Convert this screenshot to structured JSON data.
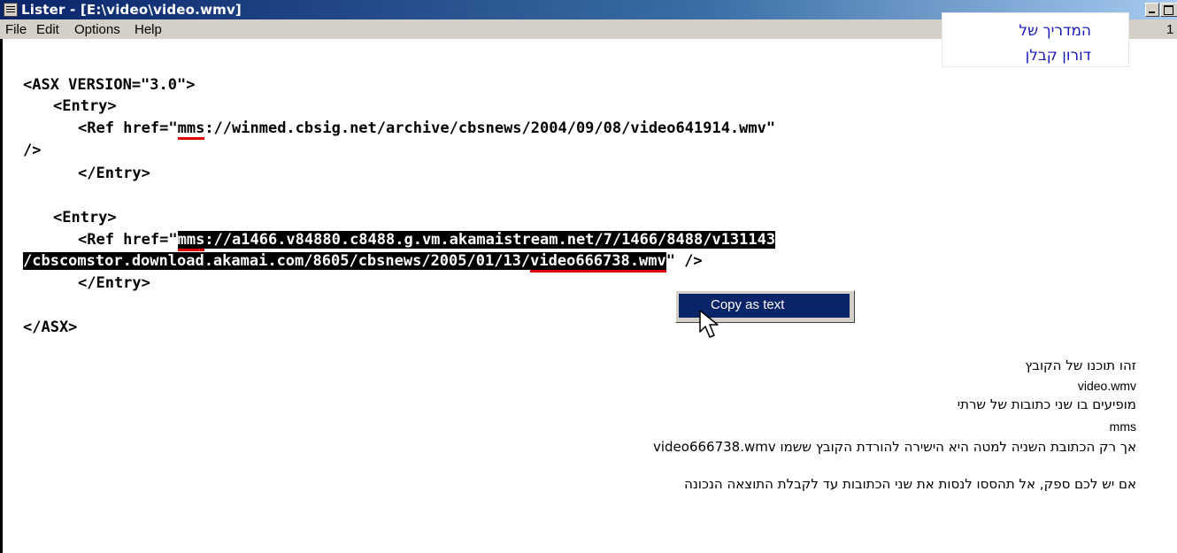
{
  "window": {
    "title": "Lister - [E:\\video\\video.wmv]",
    "page_indicator": "1"
  },
  "menu": {
    "items": [
      "File",
      "Edit",
      "Options",
      "Help"
    ]
  },
  "brand": {
    "line1": "המדריך של",
    "line2": "דורון קבלן",
    "color": "#1a1ab4"
  },
  "code_lines": {
    "l1": "<ASX VERSION=\"3.0\">",
    "l2": "<Entry>",
    "l3a": "<Ref href=\"",
    "l3b": "mms",
    "l3c": "://winmed.cbsig.net/archive/cbsnews/2004/09/08/video641914.wmv\"",
    "l4": "/>",
    "l5": "</Entry>",
    "l6": "<Entry>",
    "l7a": "<Ref href=\"",
    "l7b": "mms",
    "l7c": "://a1466.v84880.c8488.g.vm.akamaistream.net/7/1466/8488/v131143",
    "l8a": "/cbscomstor.download.akamai.com/8605/cbsnews/2005/01/13/",
    "l8b": "video666738.wmv",
    "l8c": "\"",
    "l8d": " />",
    "l9": "</Entry>",
    "l10": "</ASX>"
  },
  "context_menu": {
    "item": "Copy as text"
  },
  "notes": {
    "n1": "זהו תוכנו של הקובץ",
    "n2": "video.wmv",
    "n3": "מופיעים בו שני כתובות של שרתי",
    "n4": "mms",
    "n5": "אך רק הכתובת השניה למטה היא הישירה להורדת הקובץ  ששמו video666738.wmv",
    "n6": "אם יש לכם ספק, אל תהססו לנסות את שני הכתובות עד לקבלת התוצאה הנכונה"
  }
}
